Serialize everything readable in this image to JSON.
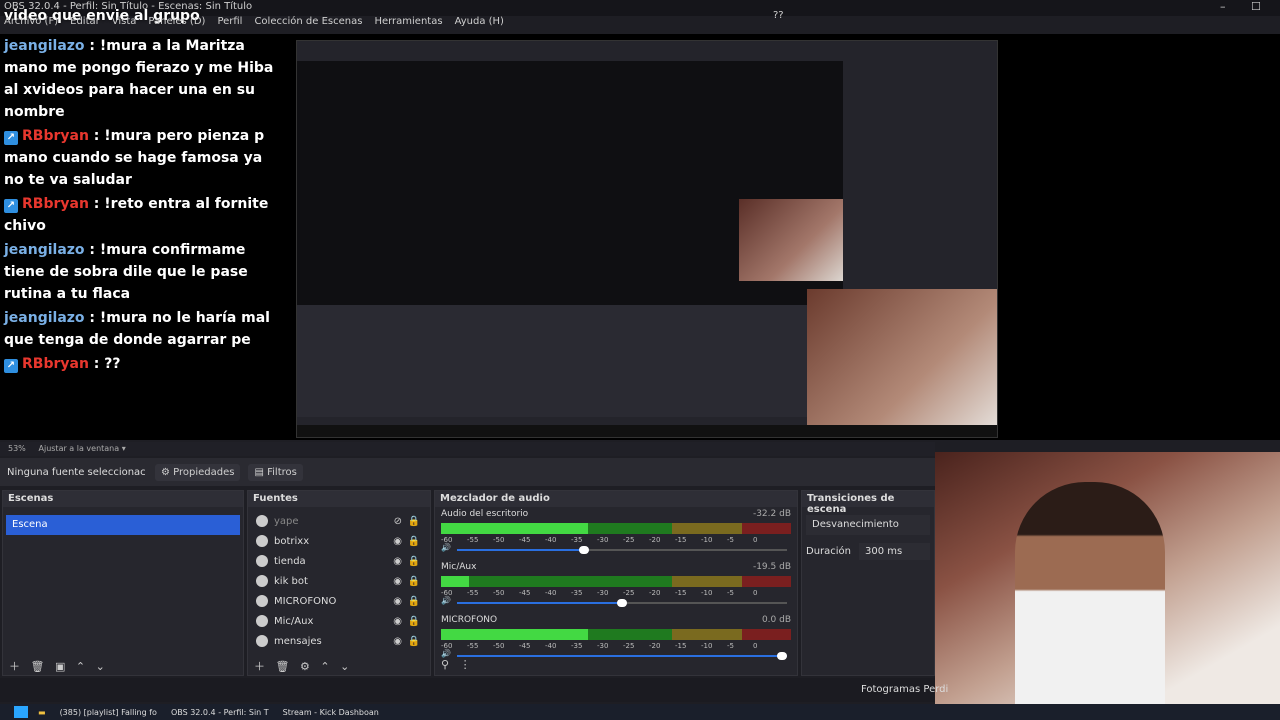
{
  "titlebar": {
    "title": "OBS 32.0.4 - Perfil: Sin Título - Escenas: Sin Título",
    "chat_top": "video que envie al grupo",
    "center_mark": "??"
  },
  "menubar": [
    "Archivo (F)",
    "Editar",
    "Vista",
    "Paneles (D)",
    "Perfil",
    "Colección de Escenas",
    "Herramientas",
    "Ayuda (H)"
  ],
  "chat": [
    {
      "user": "jeangilazo",
      "kick": false,
      "text": "!mura a la Maritza mano me pongo fierazo y me Hiba al xvideos para hacer una en su nombre"
    },
    {
      "user": "RBbryan",
      "kick": true,
      "text": "!mura pero pienza p mano cuando se hage famosa ya no te va saludar"
    },
    {
      "user": "RBbryan",
      "kick": true,
      "text": "!reto entra al fornite chivo"
    },
    {
      "user": "jeangilazo",
      "kick": false,
      "text": "!mura confirmame tiene de sobra dile que le pase rutina a tu flaca"
    },
    {
      "user": "jeangilazo",
      "kick": false,
      "text": "!mura no le haría mal que tenga de donde agarrar pe"
    },
    {
      "user": "RBbryan",
      "kick": true,
      "text": "??"
    }
  ],
  "status": {
    "zoom": "53%",
    "fit": "Ajustar a la ventana"
  },
  "toolbar": {
    "no_source": "Ninguna fuente seleccionac",
    "properties": "Propiedades",
    "filters": "Filtros"
  },
  "scenes": {
    "title": "Escenas",
    "items": [
      "Escena"
    ]
  },
  "sources": {
    "title": "Fuentes",
    "items": [
      {
        "name": "yape",
        "icon": "image-icon",
        "visible": false
      },
      {
        "name": "botrixx",
        "icon": "browser-icon",
        "visible": true
      },
      {
        "name": "tienda",
        "icon": "browser-icon",
        "visible": true
      },
      {
        "name": "kik bot",
        "icon": "browser-icon",
        "visible": true
      },
      {
        "name": "MICROFONO",
        "icon": "microphone-icon",
        "visible": true
      },
      {
        "name": "Mic/Aux",
        "icon": "microphone-icon",
        "visible": true
      },
      {
        "name": "mensajes",
        "icon": "browser-icon",
        "visible": true
      }
    ]
  },
  "mixer": {
    "title": "Mezclador de audio",
    "scale": [
      "-60",
      "-55",
      "-50",
      "-45",
      "-40",
      "-35",
      "-30",
      "-25",
      "-20",
      "-15",
      "-10",
      "-5",
      "0"
    ],
    "channels": [
      {
        "name": "Audio del escritorio",
        "db": "-32.2 dB",
        "level": 0.42,
        "volume": 0.38
      },
      {
        "name": "Mic/Aux",
        "db": "-19.5 dB",
        "level": 0.08,
        "volume": 0.5
      },
      {
        "name": "MICROFONO",
        "db": "0.0 dB",
        "level": 0.42,
        "volume": 1.0
      }
    ]
  },
  "transitions": {
    "title": "Transiciones de escena",
    "selected": "Desvanecimiento",
    "duration_label": "Duración",
    "duration_value": "300 ms"
  },
  "statusbar": {
    "frames": "Fotogramas Perdi"
  },
  "taskbar": [
    "(385) [playlist] Falling fo",
    "OBS 32.0.4 - Perfil: Sin T",
    "Stream - Kick Dashboan"
  ]
}
